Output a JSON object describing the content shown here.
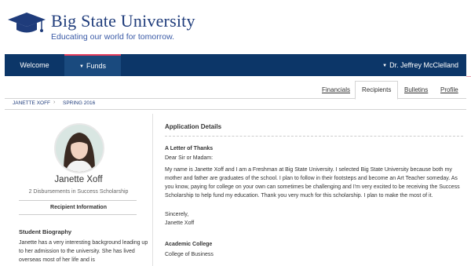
{
  "brand": {
    "name": "Big State University",
    "tagline": "Educating our world for tomorrow."
  },
  "nav": {
    "welcome": "Welcome",
    "funds": "Funds",
    "user": "Dr. Jeffrey McClelland"
  },
  "tabs": {
    "financials": "Financials",
    "recipients": "Recipients",
    "bulletins": "Bulletins",
    "profile": "Profile"
  },
  "breadcrumb": {
    "student": "JANETTE XOFF",
    "term": "SPRING 2016"
  },
  "recipient": {
    "name": "Janette Xoff",
    "disbursements": "2 Disbursements in Success Scholarship",
    "section_label": "Recipient Information",
    "bio_title": "Student Biography",
    "bio_text": "Janette has a very interesting background leading up to her admission to the university. She has lived overseas most of her life and is"
  },
  "application": {
    "title": "Application Details",
    "letter_title": "A Letter of Thanks",
    "salutation": "Dear Sir or Madam:",
    "body": "My name is Janette Xoff and I am a Freshman at Big State University. I selected Big State University because both my mother and father are graduates of the school. I plan to follow in their footsteps and become an Art Teacher someday. As you know, paying for college on your own can sometimes be challenging and I'm very excited to be receiving the Success Scholarship to help fund my education. Thank you very much for this scholarship. I plan to make the most of it.",
    "closing": "Sincerely,",
    "signer": "Janette Xoff",
    "college_title": "Academic College",
    "college_value": "College of Business"
  },
  "colors": {
    "nav_bg": "#0c3668",
    "brand": "#1f3c7b",
    "accent": "#e53d5d"
  },
  "icons": {
    "logo": "graduation-cap-icon",
    "dropdown": "caret-down-icon"
  }
}
